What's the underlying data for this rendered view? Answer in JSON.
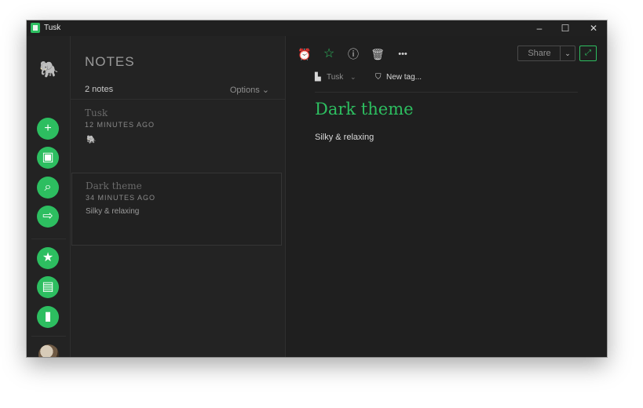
{
  "window": {
    "title": "Tusk"
  },
  "window_controls": {
    "minimize": "–",
    "maximize": "☐",
    "close": "✕"
  },
  "sidebar": {
    "logo_icon": "elephant-icon",
    "actions": [
      {
        "name": "new-note",
        "icon": "+"
      },
      {
        "name": "new-notebook",
        "icon": "▣"
      },
      {
        "name": "search",
        "icon": "⌕"
      },
      {
        "name": "work-chat",
        "icon": "⇨"
      }
    ],
    "shortcuts": [
      {
        "name": "shortcuts",
        "icon": "★"
      },
      {
        "name": "notes",
        "icon": "▤"
      },
      {
        "name": "notebooks",
        "icon": "▮"
      }
    ],
    "accent": "#2dbe60"
  },
  "notelist": {
    "title": "NOTES",
    "count": "2 notes",
    "options": "Options ⌄",
    "notes": [
      {
        "title": "Tusk",
        "time": "12 MINUTES AGO",
        "badge": "🐘"
      },
      {
        "title": "Dark theme",
        "time": "34 MINUTES AGO",
        "snippet": "Silky & relaxing"
      }
    ]
  },
  "editor": {
    "toolbar": {
      "reminder": "⏰",
      "star": "☆",
      "info": "ⓘ",
      "trash": "🗑",
      "more": "•••"
    },
    "share": "Share",
    "share_dropdown": "⌄",
    "expand": "⤢",
    "notebook_icon": "▙",
    "notebook": "Tusk",
    "notebook_chevron": "⌄",
    "tag_icon": "⛉",
    "tag": "New tag...",
    "title": "Dark theme",
    "body": "Silky & relaxing"
  }
}
